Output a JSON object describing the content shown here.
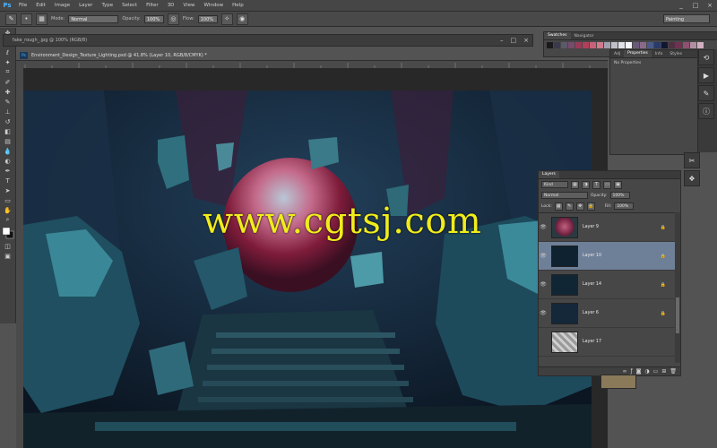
{
  "app": {
    "logo": "Ps"
  },
  "menu": [
    "File",
    "Edit",
    "Image",
    "Layer",
    "Type",
    "Select",
    "Filter",
    "3D",
    "View",
    "Window",
    "Help"
  ],
  "window_controls": [
    "_",
    "□",
    "×"
  ],
  "options_bar": {
    "mode_label": "Mode:",
    "mode_value": "Normal",
    "opacity_label": "Opacity:",
    "opacity_value": "100%",
    "flow_label": "Flow:",
    "flow_value": "100%",
    "workspace": "Painting"
  },
  "back_document": {
    "tab": "fake_rough_.jpg @ 100% (RGB/8)"
  },
  "document": {
    "tab": "Environment_Design_Texture_Lighting.psd @ 41.8% (Layer 10, RGB/8/CMYK) *"
  },
  "watermark": "www.cgtsj.com",
  "swatches_panel": {
    "tabs": [
      "Swatches",
      "Navigator"
    ],
    "colors": [
      "#1a1a1a",
      "#3a3a4a",
      "#5a5a6a",
      "#7a4a6a",
      "#9a3a5a",
      "#b0405a",
      "#c8607a",
      "#d07a8a",
      "#a0a0b0",
      "#c0c0c8",
      "#e0e0e6",
      "#f6f6f8",
      "#6a5a7a",
      "#8a6a8a",
      "#4a5a8a",
      "#2a3a6a",
      "#101830",
      "#503040",
      "#703050",
      "#905070",
      "#b090a0",
      "#d0b0c0"
    ]
  },
  "properties_panel": {
    "tabs": [
      "Adj",
      "Properties",
      "Info",
      "Styles"
    ],
    "body": "No Properties"
  },
  "layers_panel": {
    "title": "Layers",
    "kind": "Kind",
    "blend_mode": "Normal",
    "opacity_label": "Opacity:",
    "opacity_value": "100%",
    "lock_label": "Lock:",
    "fill_label": "Fill:",
    "fill_value": "100%",
    "layers": [
      {
        "name": "Layer 9"
      },
      {
        "name": "Layer 10"
      },
      {
        "name": "Layer 14"
      },
      {
        "name": "Layer 6"
      },
      {
        "name": "Layer 17"
      }
    ],
    "bottom_icons": [
      "link",
      "fx",
      "mask",
      "adjust",
      "group",
      "new",
      "trash"
    ]
  }
}
